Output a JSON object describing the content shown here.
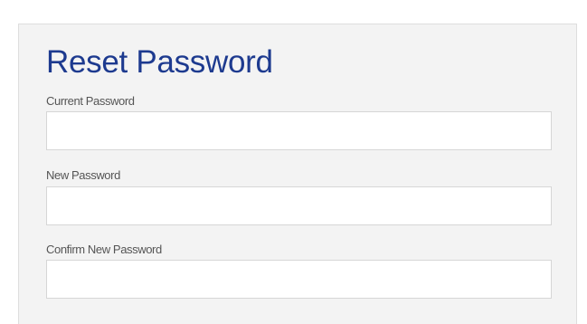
{
  "form": {
    "title": "Reset Password",
    "fields": [
      {
        "label": "Current Password",
        "value": "",
        "placeholder": ""
      },
      {
        "label": "New Password",
        "value": "",
        "placeholder": ""
      },
      {
        "label": "Confirm New Password",
        "value": "",
        "placeholder": ""
      }
    ]
  },
  "colors": {
    "title": "#1d3a8f",
    "panel_background": "#f3f3f3",
    "input_border": "#d6d6d6"
  }
}
